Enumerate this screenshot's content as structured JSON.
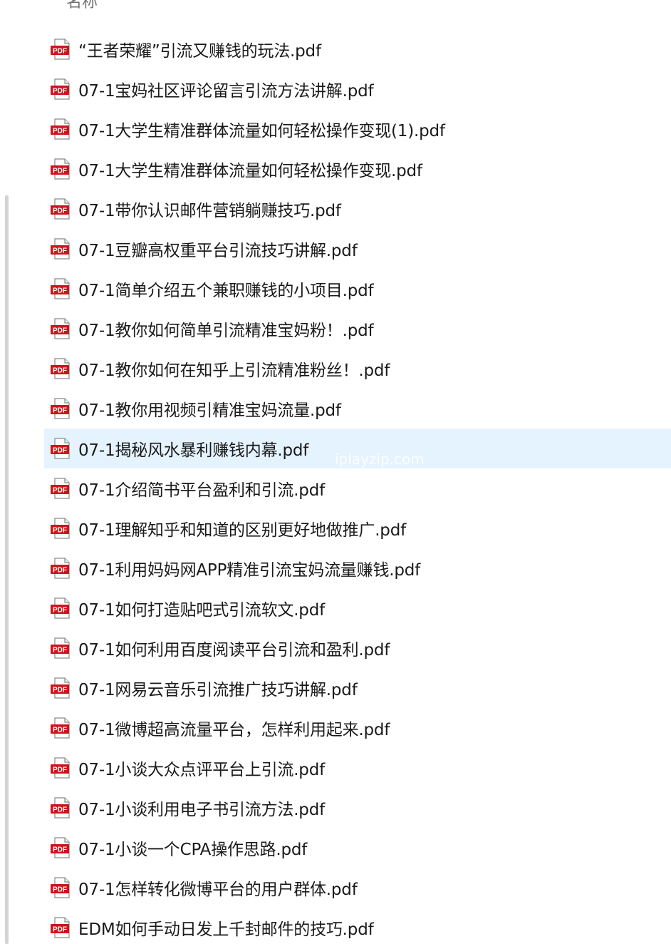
{
  "header": {
    "name_column": "名称"
  },
  "watermark": "iplayzip.com",
  "files": [
    {
      "name": "“王者荣耀”引流又赚钱的玩法.pdf",
      "icon": "pdf-file-icon"
    },
    {
      "name": "07-1宝妈社区评论留言引流方法讲解.pdf",
      "icon": "pdf-file-icon"
    },
    {
      "name": "07-1大学生精准群体流量如何轻松操作变现(1).pdf",
      "icon": "pdf-file-icon"
    },
    {
      "name": "07-1大学生精准群体流量如何轻松操作变现.pdf",
      "icon": "pdf-file-icon"
    },
    {
      "name": "07-1带你认识邮件营销躺赚技巧.pdf",
      "icon": "pdf-file-icon"
    },
    {
      "name": "07-1豆瓣高权重平台引流技巧讲解.pdf",
      "icon": "pdf-file-icon"
    },
    {
      "name": "07-1简单介绍五个兼职赚钱的小项目.pdf",
      "icon": "pdf-file-icon"
    },
    {
      "name": "07-1教你如何简单引流精准宝妈粉！.pdf",
      "icon": "pdf-file-icon"
    },
    {
      "name": "07-1教你如何在知乎上引流精准粉丝！.pdf",
      "icon": "pdf-file-icon"
    },
    {
      "name": "07-1教你用视频引精准宝妈流量.pdf",
      "icon": "pdf-file-icon"
    },
    {
      "name": "07-1揭秘风水暴利赚钱内幕.pdf",
      "icon": "pdf-file-icon",
      "selected": true
    },
    {
      "name": "07-1介绍简书平台盈利和引流.pdf",
      "icon": "pdf-file-icon"
    },
    {
      "name": "07-1理解知乎和知道的区别更好地做推广.pdf",
      "icon": "pdf-file-icon"
    },
    {
      "name": "07-1利用妈妈网APP精准引流宝妈流量赚钱.pdf",
      "icon": "pdf-file-icon"
    },
    {
      "name": "07-1如何打造贴吧式引流软文.pdf",
      "icon": "pdf-file-icon"
    },
    {
      "name": "07-1如何利用百度阅读平台引流和盈利.pdf",
      "icon": "pdf-file-icon"
    },
    {
      "name": "07-1网易云音乐引流推广技巧讲解.pdf",
      "icon": "pdf-file-icon"
    },
    {
      "name": "07-1微博超高流量平台，怎样利用起来.pdf",
      "icon": "pdf-file-icon"
    },
    {
      "name": "07-1小谈大众点评平台上引流.pdf",
      "icon": "pdf-file-icon"
    },
    {
      "name": "07-1小谈利用电子书引流方法.pdf",
      "icon": "pdf-file-icon"
    },
    {
      "name": "07-1小谈一个CPA操作思路.pdf",
      "icon": "pdf-file-icon"
    },
    {
      "name": "07-1怎样转化微博平台的用户群体.pdf",
      "icon": "pdf-file-icon"
    },
    {
      "name": "EDM如何手动日发上千封邮件的技巧.pdf",
      "icon": "pdf-file-icon"
    }
  ],
  "colors": {
    "pdf_red": "#d0121b",
    "selection": "#e5f3ff",
    "text": "#1a1a1a"
  },
  "pdf_icon_label": "PDF"
}
